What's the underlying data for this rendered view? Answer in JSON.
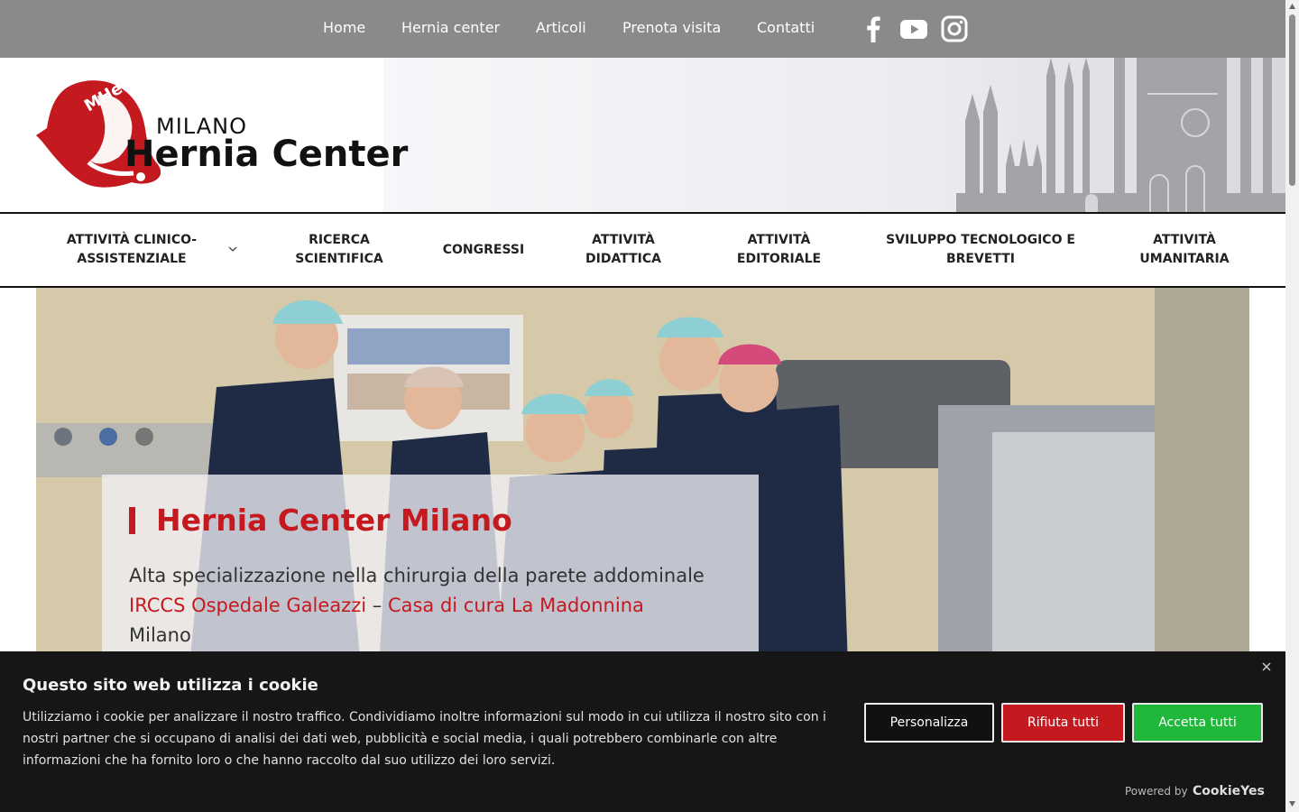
{
  "topnav": {
    "items": [
      "Home",
      "Hernia center",
      "Articoli",
      "Prenota visita",
      "Contatti"
    ],
    "social": [
      "facebook-icon",
      "youtube-icon",
      "instagram-icon"
    ]
  },
  "logo": {
    "emblem_text": "MHeC",
    "city": "MILANO",
    "name": "Hernia Center"
  },
  "mainnav": {
    "items": [
      "ATTIVITÀ CLINICO-ASSISTENZIALE",
      "RICERCA SCIENTIFICA",
      "CONGRESSI",
      "ATTIVITÀ DIDATTICA",
      "ATTIVITÀ EDITORIALE",
      "SVILUPPO TECNOLOGICO E BREVETTI",
      "ATTIVITÀ UMANITARIA"
    ]
  },
  "hero": {
    "title": "Hernia Center Milano",
    "subtitle": "Alta specializzazione nella chirurgia della parete addominale",
    "link1": "IRCCS Ospedale Galeazzi",
    "separator": " – ",
    "link2": "Casa di cura La Madonnina",
    "city": "Milano"
  },
  "cookie": {
    "title": "Questo sito web utilizza i cookie",
    "text": "Utilizziamo i cookie per analizzare il nostro traffico. Condividiamo inoltre informazioni sul modo in cui utilizza il nostro sito con i nostri partner che si occupano di analisi dei dati web, pubblicità e social media, i quali potrebbero combinarle con altre informazioni che ha fornito loro o che hanno raccolto dal suo utilizzo dei loro servizi.",
    "customize": "Personalizza",
    "reject": "Rifiuta tutti",
    "accept": "Accetta tutti",
    "powered": "Powered by",
    "brand": "CookieYes"
  },
  "colors": {
    "brand_red": "#c41a1f",
    "topbar": "#8a8a8a",
    "accept_green": "#1fb83a",
    "banner_bg": "#161616"
  }
}
